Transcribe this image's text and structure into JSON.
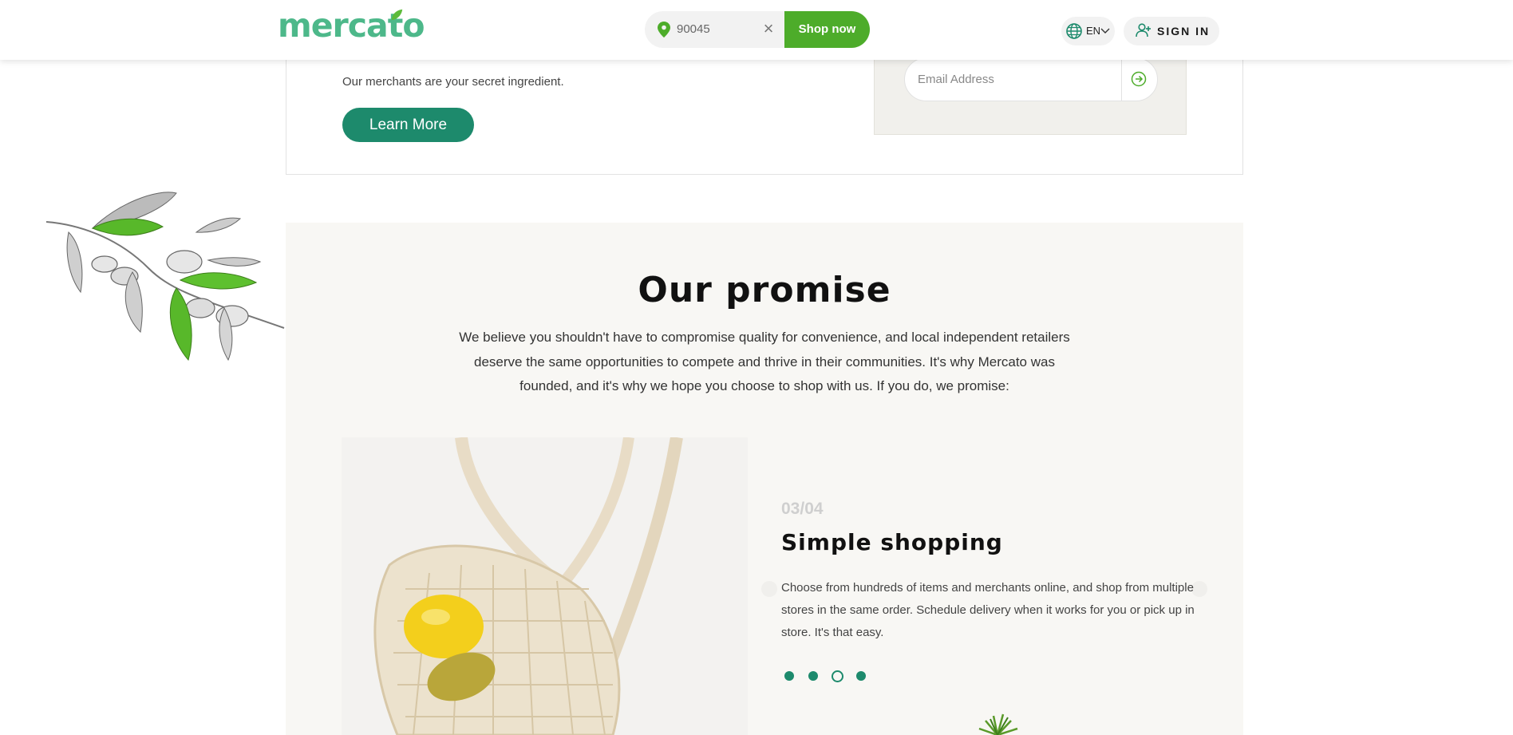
{
  "header": {
    "logo_text": "mercato",
    "zip_value": "90045",
    "clear_icon": "×",
    "shop_label": "Shop now",
    "lang_label": "EN",
    "signin_label": "SIGN IN",
    "brand_color": "#4db88a",
    "shop_color": "#4dac2a"
  },
  "top_card": {
    "tagline": "Our merchants are your secret ingredient.",
    "learn_more_label": "Learn More",
    "email_placeholder": "Email Address"
  },
  "promise": {
    "title": "Our promise",
    "body": "We believe you shouldn't have to compromise quality for convenience, and local independent retailers deserve the same opportunities to compete and thrive in their communities. It's why Mercato was founded, and it's why we hope you choose to shop with us. If you do, we promise:",
    "slide_number": "03/04",
    "slide_title": "Simple shopping",
    "slide_body": "Choose from hundreds of items and merchants online, and shop from multiple stores in the same order. Schedule delivery when it works for you or pick up in store. It's that easy.",
    "dots": [
      {
        "active": false
      },
      {
        "active": false
      },
      {
        "active": true
      },
      {
        "active": false
      }
    ],
    "accent_color": "#1d8a6c"
  },
  "icons": {
    "pin": "pin-icon",
    "clear": "close-icon",
    "globe": "globe-icon",
    "chevron": "chevron-down-icon",
    "user": "add-user-icon",
    "submit": "arrow-right-circle-icon"
  }
}
